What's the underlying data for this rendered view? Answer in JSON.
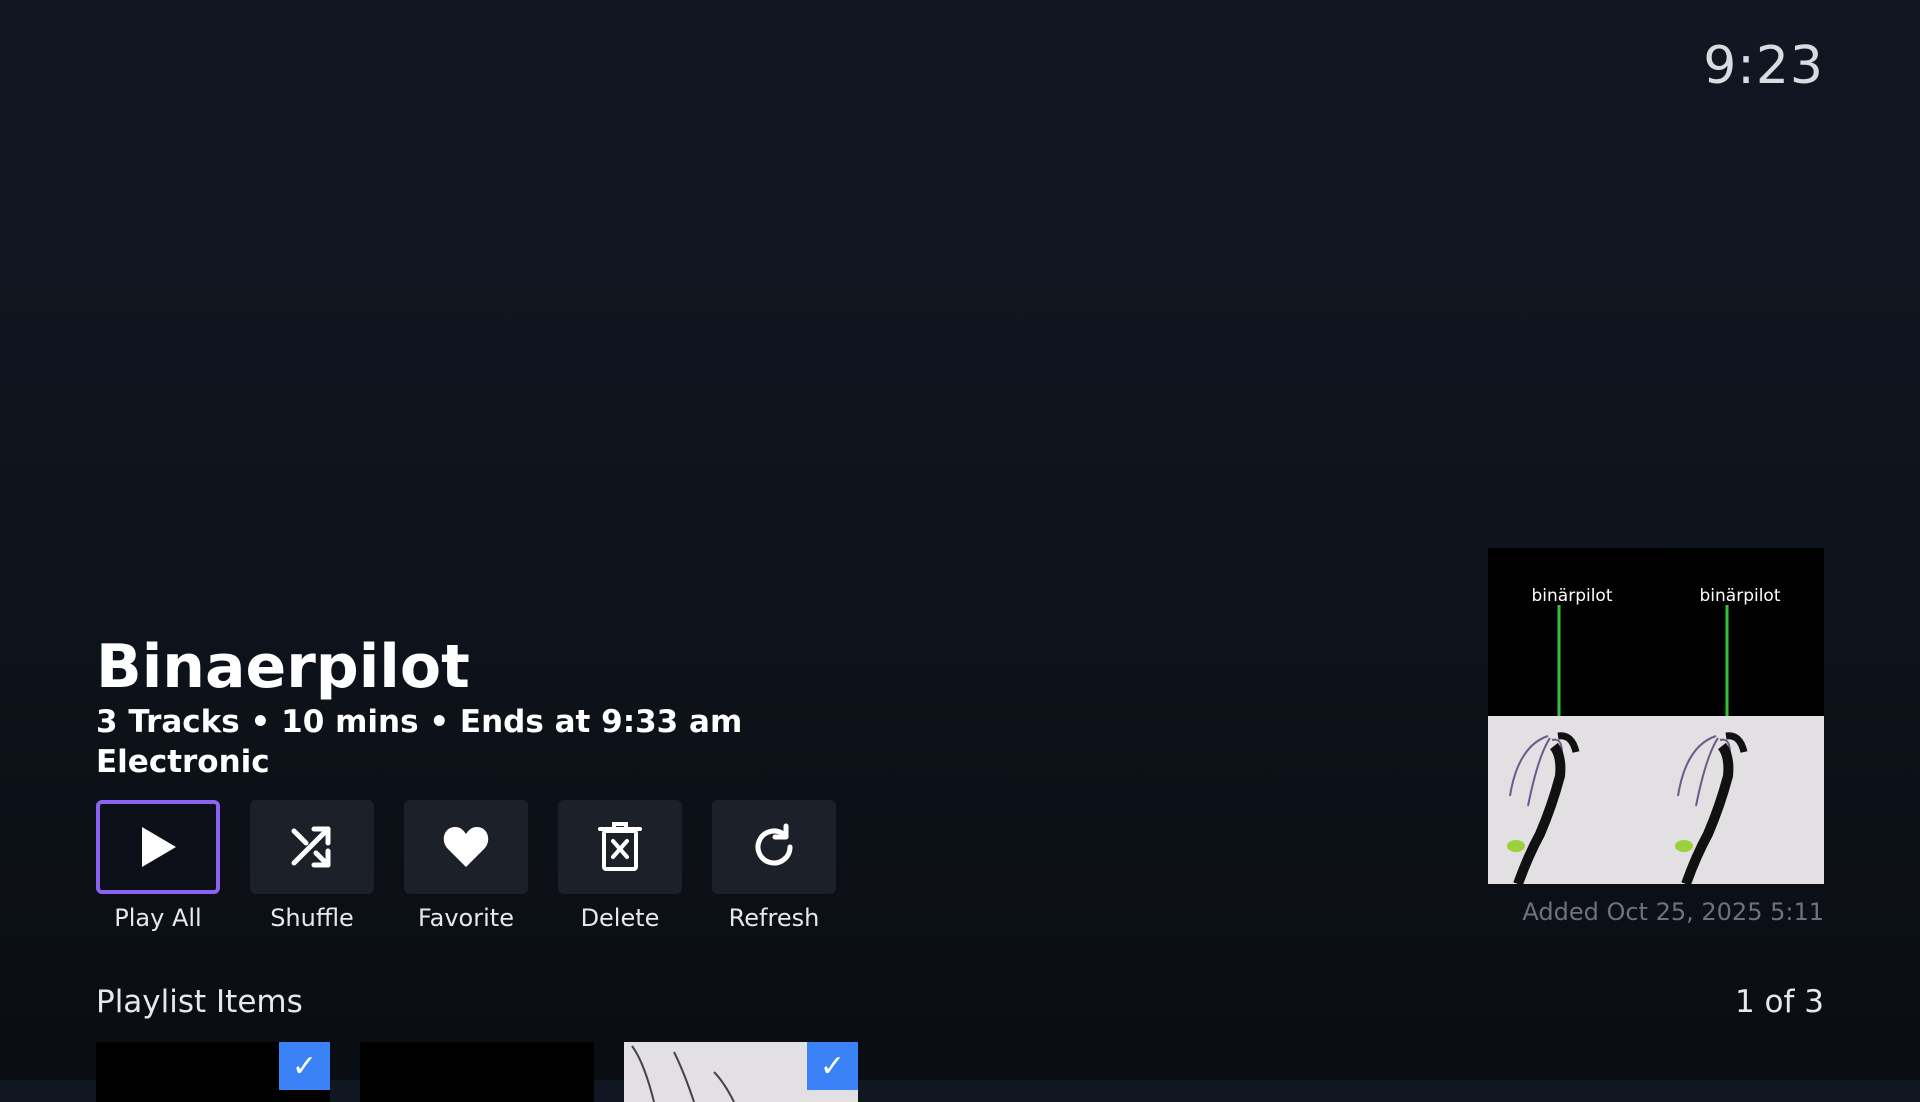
{
  "clock": "9:23",
  "playlist": {
    "title": "Binaerpilot",
    "meta": "3 Tracks • 10 mins • Ends at 9:33 am",
    "genre": "Electronic",
    "added": "Added Oct 25, 2025 5:11"
  },
  "cover": {
    "logo_text": "binärpilot"
  },
  "actions": [
    {
      "label": "Play All",
      "icon": "play-icon"
    },
    {
      "label": "Shuffle",
      "icon": "shuffle-icon"
    },
    {
      "label": "Favorite",
      "icon": "heart-icon"
    },
    {
      "label": "Delete",
      "icon": "delete-icon"
    },
    {
      "label": "Refresh",
      "icon": "refresh-icon"
    }
  ],
  "section": {
    "title": "Playlist Items",
    "counter": "1 of 3"
  },
  "items": [
    {
      "checked": true,
      "check_glyph": "✓"
    },
    {
      "checked": false
    },
    {
      "checked": true,
      "check_glyph": "✓"
    }
  ],
  "colors": {
    "focus": "#8a63f0",
    "check": "#3b82f6"
  }
}
